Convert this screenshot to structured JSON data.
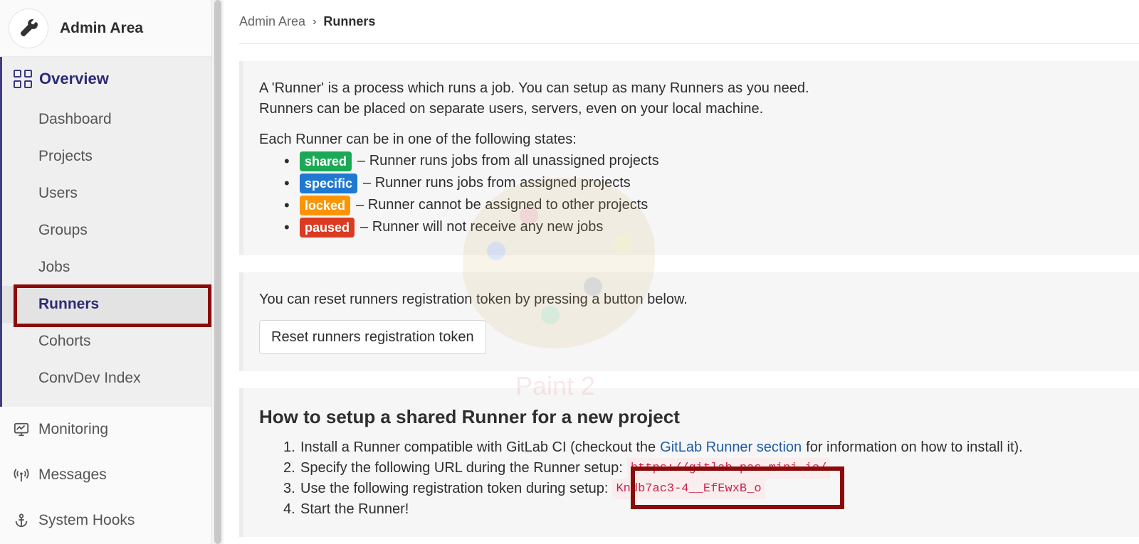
{
  "sidebar": {
    "context_title": "Admin Area",
    "context_icon": "wrench-icon",
    "overview": {
      "label": "Overview",
      "icon": "grid-icon",
      "items": [
        {
          "label": "Dashboard"
        },
        {
          "label": "Projects"
        },
        {
          "label": "Users"
        },
        {
          "label": "Groups"
        },
        {
          "label": "Jobs"
        },
        {
          "label": "Runners",
          "active": true
        },
        {
          "label": "Cohorts"
        },
        {
          "label": "ConvDev Index"
        }
      ]
    },
    "top_items": [
      {
        "label": "Monitoring",
        "icon": "monitor-icon"
      },
      {
        "label": "Messages",
        "icon": "broadcast-icon"
      },
      {
        "label": "System Hooks",
        "icon": "anchor-icon"
      }
    ]
  },
  "breadcrumb": {
    "parent": "Admin Area",
    "current": "Runners"
  },
  "intro": {
    "line1": "A 'Runner' is a process which runs a job. You can setup as many Runners as you need.",
    "line2": "Runners can be placed on separate users, servers, even on your local machine.",
    "states_heading": "Each Runner can be in one of the following states:",
    "states": [
      {
        "badge": "shared",
        "color": "#1aaa55",
        "text": "– Runner runs jobs from all unassigned projects"
      },
      {
        "badge": "specific",
        "color": "#1f78d1",
        "text": "– Runner runs jobs from assigned projects"
      },
      {
        "badge": "locked",
        "color": "#fc9403",
        "text": "– Runner cannot be assigned to other projects"
      },
      {
        "badge": "paused",
        "color": "#db3b21",
        "text": "– Runner will not receive any new jobs"
      }
    ]
  },
  "reset": {
    "text": "You can reset runners registration token by pressing a button below.",
    "button": "Reset runners registration token"
  },
  "setup": {
    "title": "How to setup a shared Runner for a new project",
    "step1_pre": "Install a Runner compatible with GitLab CI (checkout the",
    "step1_link": "GitLab Runner section",
    "step1_post": "for information on how to install it).",
    "step2_pre": "Specify the following URL during the Runner setup:",
    "step2_url": "https://gitlab.pas-mini.io/",
    "step3_pre": "Use the following registration token during setup:",
    "step3_token": "Kndb7ac3-4__EfEwxB_o",
    "step4": "Start the Runner!"
  },
  "watermark": {
    "text": "Paint 2"
  },
  "colors": {
    "highlight_box": "#8b0a0a",
    "nav_accent": "#2b2b75",
    "link": "#1f5aa6"
  }
}
